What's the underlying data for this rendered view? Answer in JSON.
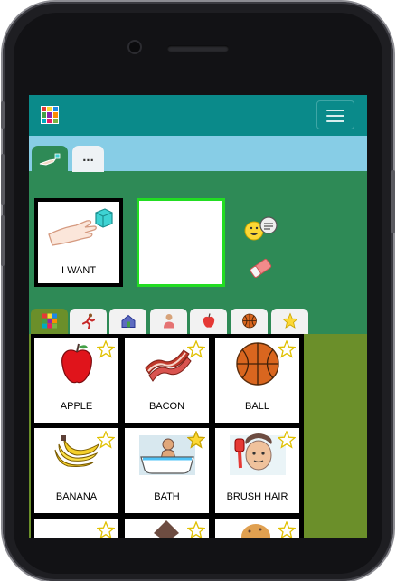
{
  "sentence": {
    "word": "I WANT"
  },
  "tabs": {
    "more_label": "..."
  },
  "categories": [
    {
      "name": "all-categories",
      "icon": "grid-icon"
    },
    {
      "name": "actions",
      "icon": "running-person-icon"
    },
    {
      "name": "places",
      "icon": "house-icon"
    },
    {
      "name": "people",
      "icon": "person-icon"
    },
    {
      "name": "food",
      "icon": "apple-icon"
    },
    {
      "name": "toys",
      "icon": "ball-icon"
    },
    {
      "name": "favorites",
      "icon": "star-icon"
    }
  ],
  "tiles": [
    {
      "label": "APPLE",
      "icon": "apple-icon",
      "favorite": false
    },
    {
      "label": "BACON",
      "icon": "bacon-icon",
      "favorite": false
    },
    {
      "label": "BALL",
      "icon": "ball-icon",
      "favorite": false
    },
    {
      "label": "BANANA",
      "icon": "banana-icon",
      "favorite": false
    },
    {
      "label": "BATH",
      "icon": "bath-icon",
      "favorite": true
    },
    {
      "label": "BRUSH HAIR",
      "icon": "brush-hair-icon",
      "favorite": false
    }
  ],
  "colors": {
    "topbar": "#0a8a8a",
    "tabstrip": "#87cde6",
    "board": "#2e8a56",
    "category_panel": "#6b8f2a",
    "selected_slot_border": "#22dd22"
  }
}
